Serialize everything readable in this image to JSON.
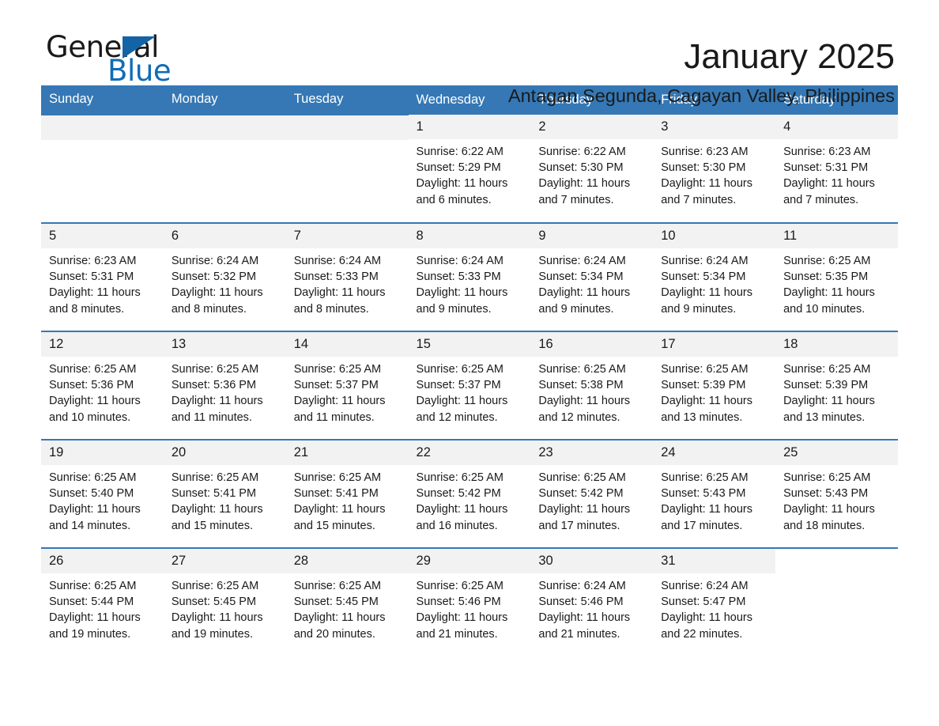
{
  "brand": {
    "name_part1": "General",
    "name_part2": "Blue",
    "triangle_color": "#1363a5",
    "blue_text_color": "#0f6cb6"
  },
  "header": {
    "month_title": "January 2025",
    "location": "Antagan Segunda, Cagayan Valley, Philippines"
  },
  "theme": {
    "header_bg": "#3578b5",
    "header_text": "#ffffff",
    "daynum_bg": "#f2f2f2",
    "divider": "#3578b5",
    "body_text": "#1a1a1a"
  },
  "weekdays": [
    "Sunday",
    "Monday",
    "Tuesday",
    "Wednesday",
    "Thursday",
    "Friday",
    "Saturday"
  ],
  "weeks": [
    [
      {
        "day": "",
        "sunrise": "",
        "sunset": "",
        "daylight_line1": "",
        "daylight_line2": "",
        "empty": true
      },
      {
        "day": "",
        "sunrise": "",
        "sunset": "",
        "daylight_line1": "",
        "daylight_line2": "",
        "empty": true
      },
      {
        "day": "",
        "sunrise": "",
        "sunset": "",
        "daylight_line1": "",
        "daylight_line2": "",
        "empty": true
      },
      {
        "day": "1",
        "sunrise": "Sunrise: 6:22 AM",
        "sunset": "Sunset: 5:29 PM",
        "daylight_line1": "Daylight: 11 hours",
        "daylight_line2": "and 6 minutes.",
        "empty": false
      },
      {
        "day": "2",
        "sunrise": "Sunrise: 6:22 AM",
        "sunset": "Sunset: 5:30 PM",
        "daylight_line1": "Daylight: 11 hours",
        "daylight_line2": "and 7 minutes.",
        "empty": false
      },
      {
        "day": "3",
        "sunrise": "Sunrise: 6:23 AM",
        "sunset": "Sunset: 5:30 PM",
        "daylight_line1": "Daylight: 11 hours",
        "daylight_line2": "and 7 minutes.",
        "empty": false
      },
      {
        "day": "4",
        "sunrise": "Sunrise: 6:23 AM",
        "sunset": "Sunset: 5:31 PM",
        "daylight_line1": "Daylight: 11 hours",
        "daylight_line2": "and 7 minutes.",
        "empty": false
      }
    ],
    [
      {
        "day": "5",
        "sunrise": "Sunrise: 6:23 AM",
        "sunset": "Sunset: 5:31 PM",
        "daylight_line1": "Daylight: 11 hours",
        "daylight_line2": "and 8 minutes.",
        "empty": false
      },
      {
        "day": "6",
        "sunrise": "Sunrise: 6:24 AM",
        "sunset": "Sunset: 5:32 PM",
        "daylight_line1": "Daylight: 11 hours",
        "daylight_line2": "and 8 minutes.",
        "empty": false
      },
      {
        "day": "7",
        "sunrise": "Sunrise: 6:24 AM",
        "sunset": "Sunset: 5:33 PM",
        "daylight_line1": "Daylight: 11 hours",
        "daylight_line2": "and 8 minutes.",
        "empty": false
      },
      {
        "day": "8",
        "sunrise": "Sunrise: 6:24 AM",
        "sunset": "Sunset: 5:33 PM",
        "daylight_line1": "Daylight: 11 hours",
        "daylight_line2": "and 9 minutes.",
        "empty": false
      },
      {
        "day": "9",
        "sunrise": "Sunrise: 6:24 AM",
        "sunset": "Sunset: 5:34 PM",
        "daylight_line1": "Daylight: 11 hours",
        "daylight_line2": "and 9 minutes.",
        "empty": false
      },
      {
        "day": "10",
        "sunrise": "Sunrise: 6:24 AM",
        "sunset": "Sunset: 5:34 PM",
        "daylight_line1": "Daylight: 11 hours",
        "daylight_line2": "and 9 minutes.",
        "empty": false
      },
      {
        "day": "11",
        "sunrise": "Sunrise: 6:25 AM",
        "sunset": "Sunset: 5:35 PM",
        "daylight_line1": "Daylight: 11 hours",
        "daylight_line2": "and 10 minutes.",
        "empty": false
      }
    ],
    [
      {
        "day": "12",
        "sunrise": "Sunrise: 6:25 AM",
        "sunset": "Sunset: 5:36 PM",
        "daylight_line1": "Daylight: 11 hours",
        "daylight_line2": "and 10 minutes.",
        "empty": false
      },
      {
        "day": "13",
        "sunrise": "Sunrise: 6:25 AM",
        "sunset": "Sunset: 5:36 PM",
        "daylight_line1": "Daylight: 11 hours",
        "daylight_line2": "and 11 minutes.",
        "empty": false
      },
      {
        "day": "14",
        "sunrise": "Sunrise: 6:25 AM",
        "sunset": "Sunset: 5:37 PM",
        "daylight_line1": "Daylight: 11 hours",
        "daylight_line2": "and 11 minutes.",
        "empty": false
      },
      {
        "day": "15",
        "sunrise": "Sunrise: 6:25 AM",
        "sunset": "Sunset: 5:37 PM",
        "daylight_line1": "Daylight: 11 hours",
        "daylight_line2": "and 12 minutes.",
        "empty": false
      },
      {
        "day": "16",
        "sunrise": "Sunrise: 6:25 AM",
        "sunset": "Sunset: 5:38 PM",
        "daylight_line1": "Daylight: 11 hours",
        "daylight_line2": "and 12 minutes.",
        "empty": false
      },
      {
        "day": "17",
        "sunrise": "Sunrise: 6:25 AM",
        "sunset": "Sunset: 5:39 PM",
        "daylight_line1": "Daylight: 11 hours",
        "daylight_line2": "and 13 minutes.",
        "empty": false
      },
      {
        "day": "18",
        "sunrise": "Sunrise: 6:25 AM",
        "sunset": "Sunset: 5:39 PM",
        "daylight_line1": "Daylight: 11 hours",
        "daylight_line2": "and 13 minutes.",
        "empty": false
      }
    ],
    [
      {
        "day": "19",
        "sunrise": "Sunrise: 6:25 AM",
        "sunset": "Sunset: 5:40 PM",
        "daylight_line1": "Daylight: 11 hours",
        "daylight_line2": "and 14 minutes.",
        "empty": false
      },
      {
        "day": "20",
        "sunrise": "Sunrise: 6:25 AM",
        "sunset": "Sunset: 5:41 PM",
        "daylight_line1": "Daylight: 11 hours",
        "daylight_line2": "and 15 minutes.",
        "empty": false
      },
      {
        "day": "21",
        "sunrise": "Sunrise: 6:25 AM",
        "sunset": "Sunset: 5:41 PM",
        "daylight_line1": "Daylight: 11 hours",
        "daylight_line2": "and 15 minutes.",
        "empty": false
      },
      {
        "day": "22",
        "sunrise": "Sunrise: 6:25 AM",
        "sunset": "Sunset: 5:42 PM",
        "daylight_line1": "Daylight: 11 hours",
        "daylight_line2": "and 16 minutes.",
        "empty": false
      },
      {
        "day": "23",
        "sunrise": "Sunrise: 6:25 AM",
        "sunset": "Sunset: 5:42 PM",
        "daylight_line1": "Daylight: 11 hours",
        "daylight_line2": "and 17 minutes.",
        "empty": false
      },
      {
        "day": "24",
        "sunrise": "Sunrise: 6:25 AM",
        "sunset": "Sunset: 5:43 PM",
        "daylight_line1": "Daylight: 11 hours",
        "daylight_line2": "and 17 minutes.",
        "empty": false
      },
      {
        "day": "25",
        "sunrise": "Sunrise: 6:25 AM",
        "sunset": "Sunset: 5:43 PM",
        "daylight_line1": "Daylight: 11 hours",
        "daylight_line2": "and 18 minutes.",
        "empty": false
      }
    ],
    [
      {
        "day": "26",
        "sunrise": "Sunrise: 6:25 AM",
        "sunset": "Sunset: 5:44 PM",
        "daylight_line1": "Daylight: 11 hours",
        "daylight_line2": "and 19 minutes.",
        "empty": false
      },
      {
        "day": "27",
        "sunrise": "Sunrise: 6:25 AM",
        "sunset": "Sunset: 5:45 PM",
        "daylight_line1": "Daylight: 11 hours",
        "daylight_line2": "and 19 minutes.",
        "empty": false
      },
      {
        "day": "28",
        "sunrise": "Sunrise: 6:25 AM",
        "sunset": "Sunset: 5:45 PM",
        "daylight_line1": "Daylight: 11 hours",
        "daylight_line2": "and 20 minutes.",
        "empty": false
      },
      {
        "day": "29",
        "sunrise": "Sunrise: 6:25 AM",
        "sunset": "Sunset: 5:46 PM",
        "daylight_line1": "Daylight: 11 hours",
        "daylight_line2": "and 21 minutes.",
        "empty": false
      },
      {
        "day": "30",
        "sunrise": "Sunrise: 6:24 AM",
        "sunset": "Sunset: 5:46 PM",
        "daylight_line1": "Daylight: 11 hours",
        "daylight_line2": "and 21 minutes.",
        "empty": false
      },
      {
        "day": "31",
        "sunrise": "Sunrise: 6:24 AM",
        "sunset": "Sunset: 5:47 PM",
        "daylight_line1": "Daylight: 11 hours",
        "daylight_line2": "and 22 minutes.",
        "empty": false
      },
      {
        "day": "",
        "sunrise": "",
        "sunset": "",
        "daylight_line1": "",
        "daylight_line2": "",
        "empty": true,
        "blank": true
      }
    ]
  ]
}
